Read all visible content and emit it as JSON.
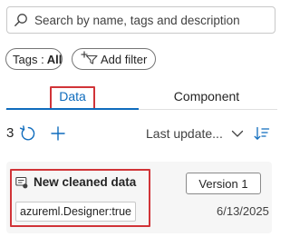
{
  "search": {
    "placeholder": "Search by name, tags and description",
    "icon": "search-icon"
  },
  "filters": {
    "tags_label": "Tags :",
    "tags_value": "All",
    "add_filter_label": "Add filter"
  },
  "tabs": [
    {
      "label": "Data",
      "selected": true
    },
    {
      "label": "Component",
      "selected": false
    }
  ],
  "toolbar": {
    "count": "3",
    "sort_label": "Last update...",
    "icons": [
      "refresh-icon",
      "add-icon",
      "chevron-down-icon",
      "sort-icon"
    ]
  },
  "items": [
    {
      "name": "New cleaned data",
      "tag": "azureml.Designer:true",
      "version_label": "Version 1",
      "date": "6/13/2025"
    }
  ],
  "colors": {
    "accent": "#0f6cbd",
    "highlight": "#d13438",
    "card_bg": "#f6f6f6"
  }
}
